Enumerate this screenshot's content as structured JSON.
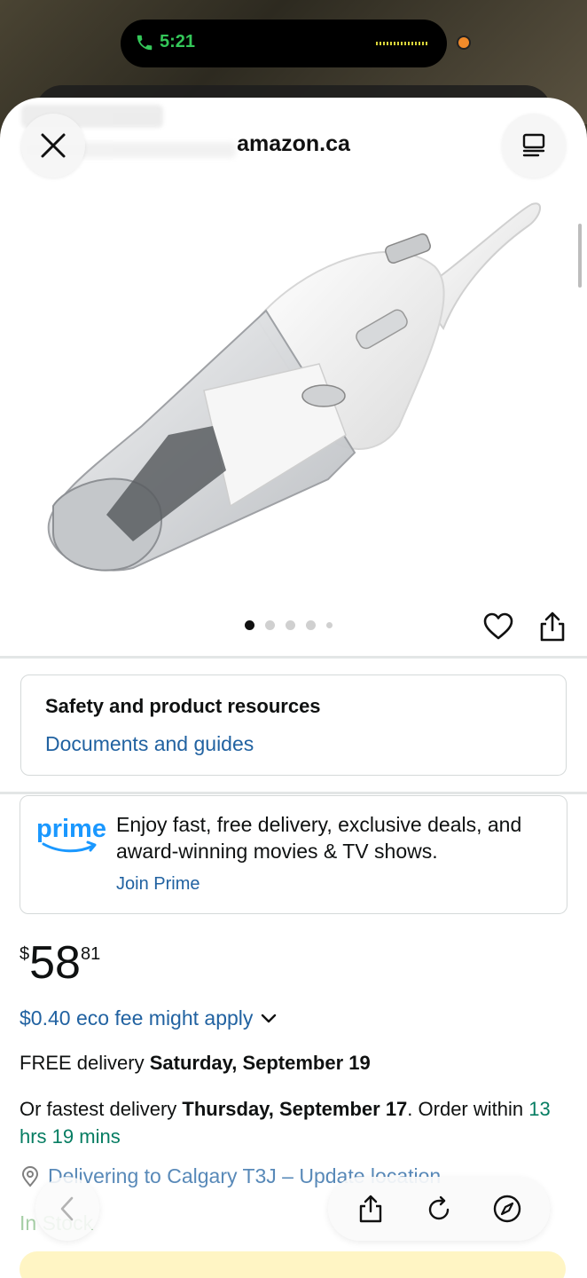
{
  "status_bar": {
    "call_time": "5:21"
  },
  "browser": {
    "site": "amazon.ca"
  },
  "carousel": {
    "active_index": 0,
    "count": 5
  },
  "safety": {
    "title": "Safety and product resources",
    "link": "Documents and guides"
  },
  "prime": {
    "logo_text": "prime",
    "message": "Enjoy fast, free delivery, exclusive deals, and award-winning movies & TV shows.",
    "join": "Join Prime"
  },
  "price": {
    "symbol": "$",
    "whole": "58",
    "fraction": "81"
  },
  "eco_fee": "$0.40 eco fee might apply",
  "free_delivery": {
    "prefix": "FREE delivery ",
    "date": "Saturday, September 19"
  },
  "fastest_delivery": {
    "prefix": "Or fastest delivery ",
    "date": "Thursday, September 17",
    "middle": ". Order within ",
    "countdown": "13 hrs 19 mins"
  },
  "location": "Delivering to Calgary T3J – Update location",
  "stock": "In Stock",
  "colors": {
    "link": "#2162a1",
    "green": "#067d62",
    "prime_blue": "#1a98ff"
  }
}
